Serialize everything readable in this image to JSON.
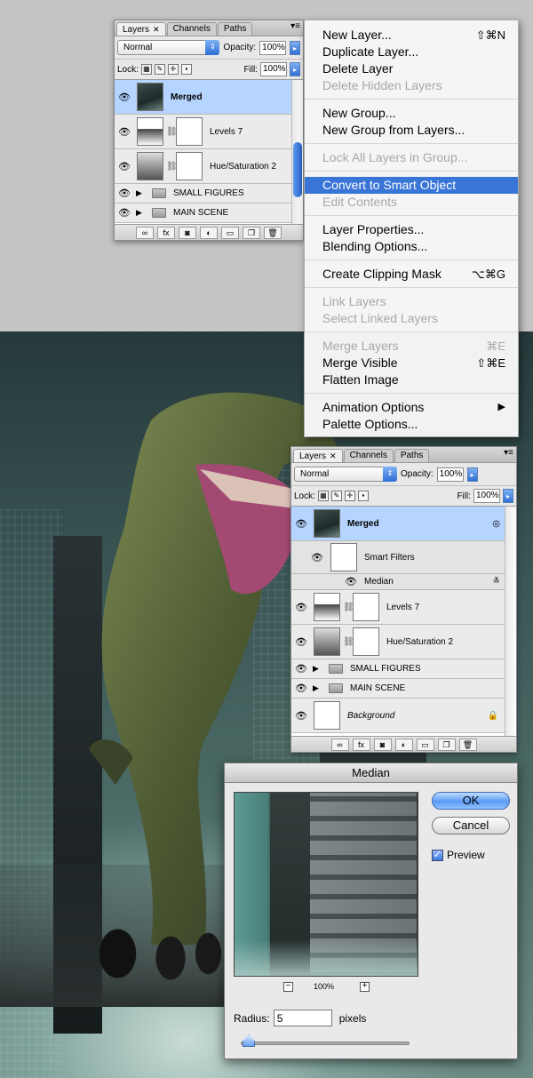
{
  "panel_top": {
    "tabs": [
      {
        "label": "Layers"
      },
      {
        "label": "Channels"
      },
      {
        "label": "Paths"
      }
    ],
    "blend_mode": "Normal",
    "opacity_label": "Opacity:",
    "opacity": "100%",
    "lock_label": "Lock:",
    "fill_label": "Fill:",
    "fill": "100%",
    "layers": [
      {
        "name": "Merged"
      },
      {
        "name": "Levels 7"
      },
      {
        "name": "Hue/Saturation 2"
      }
    ],
    "groups": [
      {
        "name": "SMALL FIGURES"
      },
      {
        "name": "MAIN SCENE"
      }
    ]
  },
  "menu": {
    "items": [
      {
        "label": "New Layer...",
        "shortcut": "⇧⌘N"
      },
      {
        "label": "Duplicate Layer..."
      },
      {
        "label": "Delete Layer"
      },
      {
        "label": "Delete Hidden Layers",
        "disabled": true
      },
      {
        "label": "New Group..."
      },
      {
        "label": "New Group from Layers..."
      },
      {
        "label": "Lock All Layers in Group...",
        "disabled": true
      },
      {
        "label": "Convert to Smart Object",
        "highlighted": true
      },
      {
        "label": "Edit Contents",
        "disabled": true
      },
      {
        "label": "Layer Properties..."
      },
      {
        "label": "Blending Options..."
      },
      {
        "label": "Create Clipping Mask",
        "shortcut": "⌥⌘G"
      },
      {
        "label": "Link Layers",
        "disabled": true
      },
      {
        "label": "Select Linked Layers",
        "disabled": true
      },
      {
        "label": "Merge Layers",
        "shortcut": "⌘E",
        "disabled": true
      },
      {
        "label": "Merge Visible",
        "shortcut": "⇧⌘E"
      },
      {
        "label": "Flatten Image"
      },
      {
        "label": "Animation Options"
      },
      {
        "label": "Palette Options..."
      }
    ]
  },
  "panel_bottom": {
    "tabs": [
      {
        "label": "Layers"
      },
      {
        "label": "Channels"
      },
      {
        "label": "Paths"
      }
    ],
    "blend_mode": "Normal",
    "opacity_label": "Opacity:",
    "opacity": "100%",
    "lock_label": "Lock:",
    "fill_label": "Fill:",
    "fill": "100%",
    "merged": "Merged",
    "smart_filters": "Smart Filters",
    "median": "Median",
    "levels": "Levels 7",
    "hue": "Hue/Saturation 2",
    "groups": [
      {
        "name": "SMALL FIGURES"
      },
      {
        "name": "MAIN SCENE"
      }
    ],
    "background": "Background"
  },
  "dialog": {
    "title": "Median",
    "ok": "OK",
    "cancel": "Cancel",
    "preview": "Preview",
    "zoom": "100%",
    "radius_label": "Radius:",
    "radius": "5",
    "unit": "pixels"
  }
}
